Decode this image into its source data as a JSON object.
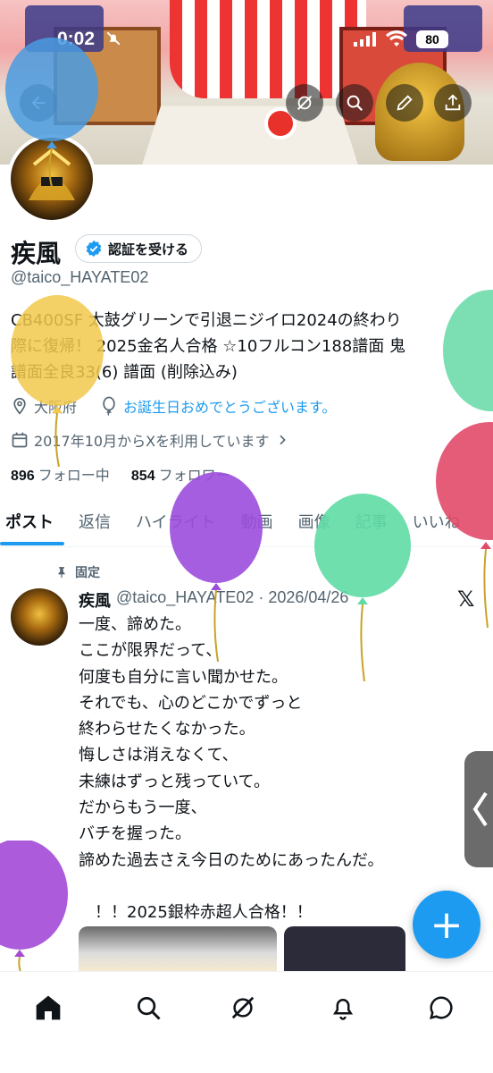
{
  "status_bar": {
    "time": "0:02",
    "battery": "80"
  },
  "profile": {
    "name": "疾風",
    "verify_label": "認証を受ける",
    "handle": "@taico_HAYATE02",
    "bio_lines": [
      "CB400SF 太鼓グリーンで引退ニジイロ2024の終わり",
      "際に復帰！ 2025金名人合格 ☆10フルコン188譜面 鬼",
      "譜面全良33(6) 譜面 (削除込み)"
    ],
    "location": "大阪府",
    "birthday": "お誕生日おめでとうございます。",
    "joined": "2017年10月からXを利用しています",
    "following_count": "896",
    "following_label": "フォロー中",
    "followers_count": "854",
    "followers_label": "フォロワー"
  },
  "tabs": [
    "ポスト",
    "返信",
    "ハイライト",
    "動画",
    "画像",
    "記事",
    "いいね"
  ],
  "pinned_tweet": {
    "pinned_label": "固定",
    "author": "疾風",
    "meta": "@taico_HAYATE02 · 2026/04/26",
    "lines": [
      "一度、諦めた。",
      "ここが限界だって、",
      "何度も自分に言い聞かせた。",
      "それでも、心のどこかでずっと",
      "終わらせたくなかった。",
      "悔しさは消えなくて、",
      "未練はずっと残っていて。",
      "だからもう一度、",
      "バチを握った。",
      "諦めた過去さえ今日のためにあったんだ。",
      "",
      "　！！2025銀枠赤超人合格！！"
    ]
  },
  "colors": {
    "accent": "#1d9bf0",
    "text": "#0f1419",
    "muted": "#536471"
  },
  "icons": [
    "back-arrow-icon",
    "grok-icon",
    "search-icon",
    "edit-icon",
    "share-icon",
    "verified-badge-icon",
    "location-icon",
    "balloon-icon",
    "calendar-icon",
    "chevron-right-icon",
    "pin-icon",
    "x-logo-icon",
    "compose-plus-icon",
    "home-icon",
    "explore-search-icon",
    "grok-nav-icon",
    "notifications-icon",
    "messages-icon"
  ]
}
